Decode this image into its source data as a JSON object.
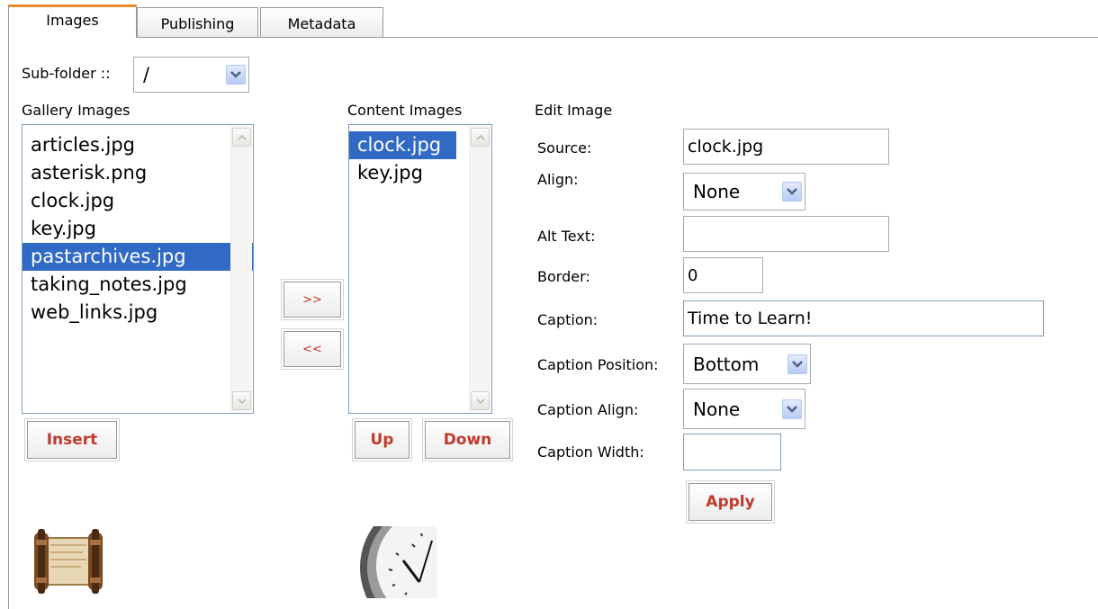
{
  "tabs": [
    {
      "label": "Images",
      "active": true
    },
    {
      "label": "Publishing",
      "active": false
    },
    {
      "label": "Metadata",
      "active": false
    }
  ],
  "subfolder": {
    "label": "Sub-folder ::",
    "value": "/"
  },
  "gallery": {
    "heading": "Gallery Images",
    "items": [
      "articles.jpg",
      "asterisk.png",
      "clock.jpg",
      "key.jpg",
      "pastarchives.jpg",
      "taking_notes.jpg",
      "web_links.jpg"
    ],
    "selected_index": 4,
    "insert_label": "Insert"
  },
  "transfer": {
    "add_label": ">>",
    "remove_label": "<<"
  },
  "content": {
    "heading": "Content Images",
    "items": [
      "clock.jpg",
      "key.jpg"
    ],
    "selected_index": 0,
    "up_label": "Up",
    "down_label": "Down"
  },
  "edit": {
    "heading": "Edit Image",
    "source_label": "Source:",
    "source_value": "clock.jpg",
    "align_label": "Align:",
    "align_value": "None",
    "alt_label": "Alt Text:",
    "alt_value": "",
    "border_label": "Border:",
    "border_value": "0",
    "caption_label": "Caption:",
    "caption_value": "Time to Learn!",
    "caption_position_label": "Caption Position:",
    "caption_position_value": "Bottom",
    "caption_align_label": "Caption Align:",
    "caption_align_value": "None",
    "caption_width_label": "Caption Width:",
    "caption_width_value": "",
    "apply_label": "Apply"
  },
  "previews": {
    "gallery_icon": "scroll-icon",
    "content_icon": "clock-icon"
  },
  "colors": {
    "selection": "#316ac5",
    "button_text": "#c0392b",
    "active_tab_accent": "#e68b2c"
  }
}
